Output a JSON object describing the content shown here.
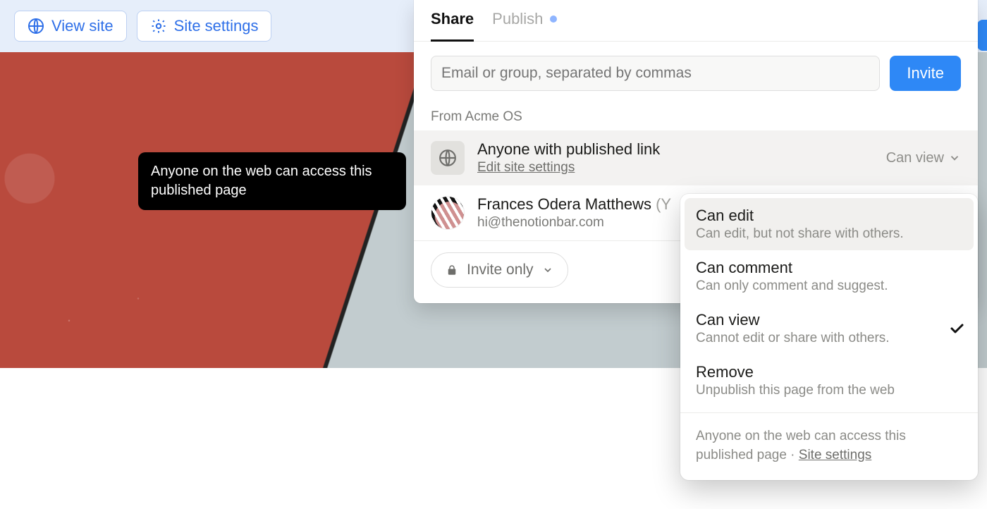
{
  "topbar": {
    "view_site": "View site",
    "site_settings": "Site settings"
  },
  "tooltip": {
    "text": "Anyone on the web can access this published page"
  },
  "share": {
    "tabs": {
      "share": "Share",
      "publish": "Publish"
    },
    "invite_placeholder": "Email or group, separated by commas",
    "invite_button": "Invite",
    "from_label": "From Acme OS",
    "published": {
      "title": "Anyone with published link",
      "edit_link": "Edit site settings",
      "perm": "Can view"
    },
    "owner": {
      "name": "Frances Odera Matthews",
      "you_suffix": "(Y",
      "email": "hi@thenotionbar.com"
    },
    "invite_only": "Invite only"
  },
  "dropdown": {
    "items": [
      {
        "title": "Can edit",
        "sub": "Can edit, but not share with others.",
        "hover": true,
        "checked": false
      },
      {
        "title": "Can comment",
        "sub": "Can only comment and suggest.",
        "hover": false,
        "checked": false
      },
      {
        "title": "Can view",
        "sub": "Cannot edit or share with others.",
        "hover": false,
        "checked": true
      },
      {
        "title": "Remove",
        "sub": "Unpublish this page from the web",
        "hover": false,
        "checked": false
      }
    ],
    "footer_text": "Anyone on the web can access this published page · ",
    "footer_link": "Site settings"
  }
}
